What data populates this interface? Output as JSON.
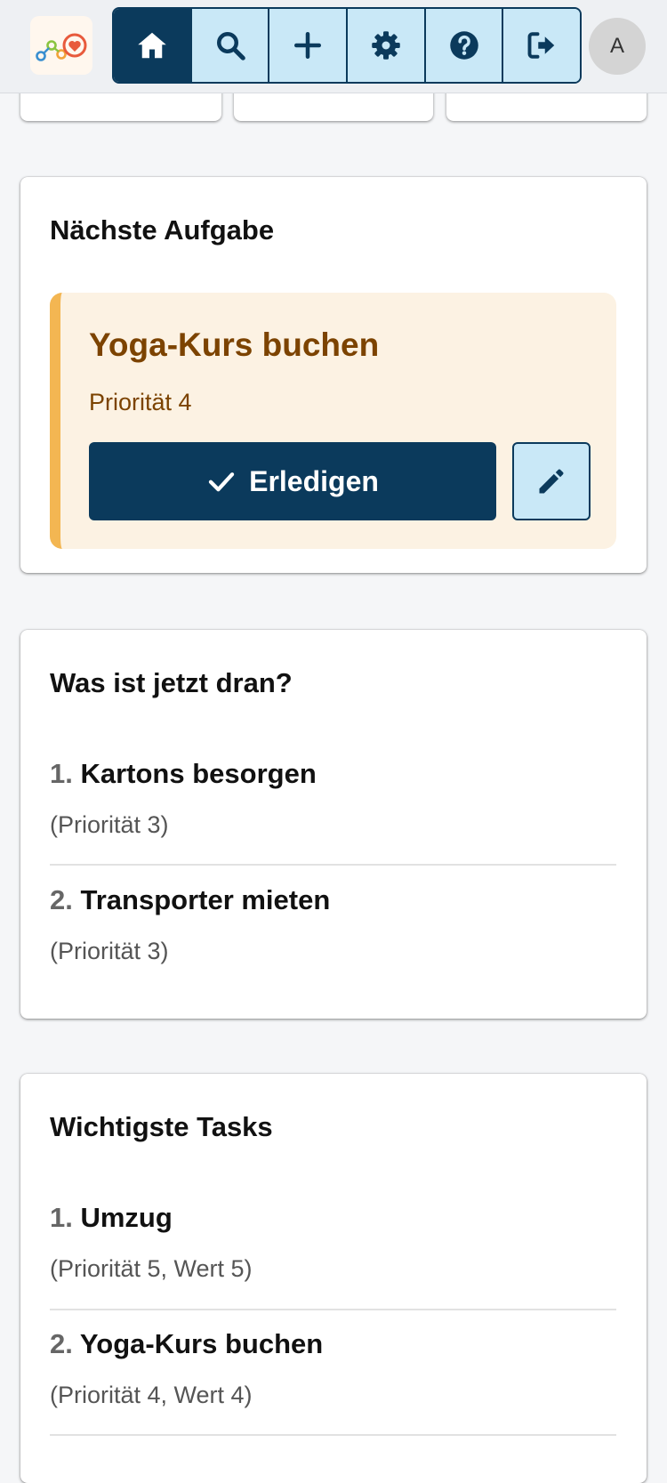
{
  "header": {
    "avatar_initial": "A",
    "nav": [
      {
        "name": "home",
        "icon": "home-icon",
        "active": true
      },
      {
        "name": "search",
        "icon": "search-icon"
      },
      {
        "name": "add",
        "icon": "plus-icon"
      },
      {
        "name": "settings",
        "icon": "gear-icon"
      },
      {
        "name": "help",
        "icon": "question-circle-icon"
      },
      {
        "name": "logout",
        "icon": "sign-out-icon"
      }
    ]
  },
  "next_task": {
    "heading": "Nächste Aufgabe",
    "title": "Yoga-Kurs buchen",
    "priority": "Priorität 4",
    "done_label": "Erledigen"
  },
  "now_due": {
    "heading": "Was ist jetzt dran?",
    "items": [
      {
        "num": "1.",
        "name": "Kartons besorgen",
        "detail": "(Priorität 3)"
      },
      {
        "num": "2.",
        "name": "Transporter mieten",
        "detail": "(Priorität 3)"
      }
    ]
  },
  "top_tasks": {
    "heading": "Wichtigste Tasks",
    "items": [
      {
        "num": "1.",
        "name": "Umzug",
        "detail": "(Priorität 5, Wert 5)"
      },
      {
        "num": "2.",
        "name": "Yoga-Kurs buchen",
        "detail": "(Priorität 4, Wert 4)"
      }
    ]
  },
  "colors": {
    "primary": "#0b3a5c",
    "nav_bg": "#c9e8f7",
    "highlight_bg": "#fcf2e3",
    "highlight_border": "#f3b652",
    "highlight_text": "#7c4300"
  }
}
